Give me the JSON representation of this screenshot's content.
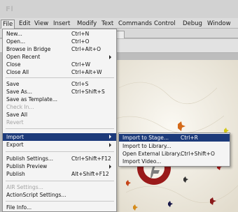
{
  "app": {
    "logo": "Fl"
  },
  "menubar": [
    "File",
    "Edit",
    "View",
    "Insert",
    "Modify",
    "Text",
    "Commands",
    "Control",
    "Debug",
    "Window"
  ],
  "document_tab": {
    "close_glyph": "×"
  },
  "file_menu": [
    {
      "label": "New...",
      "shortcut": "Ctrl+N"
    },
    {
      "label": "Open...",
      "shortcut": "Ctrl+O"
    },
    {
      "label": "Browse in Bridge",
      "shortcut": "Ctrl+Alt+O"
    },
    {
      "label": "Open Recent",
      "shortcut": "",
      "submenu": true
    },
    {
      "label": "Close",
      "shortcut": "Ctrl+W"
    },
    {
      "label": "Close All",
      "shortcut": "Ctrl+Alt+W"
    },
    {
      "label": "Save",
      "shortcut": "Ctrl+S"
    },
    {
      "label": "Save As...",
      "shortcut": "Ctrl+Shift+S"
    },
    {
      "label": "Save as Template...",
      "shortcut": ""
    },
    {
      "label": "Check In...",
      "shortcut": "",
      "disabled": true
    },
    {
      "label": "Save All",
      "shortcut": ""
    },
    {
      "label": "Revert",
      "shortcut": "",
      "disabled": true
    },
    {
      "label": "Import",
      "shortcut": "",
      "submenu": true,
      "selected": true
    },
    {
      "label": "Export",
      "shortcut": "",
      "submenu": true
    },
    {
      "label": "Publish Settings...",
      "shortcut": "Ctrl+Shift+F12"
    },
    {
      "label": "Publish Preview",
      "shortcut": "",
      "submenu": true
    },
    {
      "label": "Publish",
      "shortcut": "Alt+Shift+F12"
    },
    {
      "label": "AIR Settings...",
      "shortcut": "",
      "disabled": true
    },
    {
      "label": "ActionScript Settings...",
      "shortcut": ""
    },
    {
      "label": "File Info...",
      "shortcut": ""
    }
  ],
  "import_submenu": [
    {
      "label": "Import to Stage...",
      "shortcut": "Ctrl+R",
      "selected": true
    },
    {
      "label": "Import to Library...",
      "shortcut": ""
    },
    {
      "label": "Open External Library...",
      "shortcut": "Ctrl+Shift+O"
    },
    {
      "label": "Import Video...",
      "shortcut": ""
    }
  ],
  "colors": {
    "menu_bg": "#f4f4f4",
    "highlight": "#1c3a7a",
    "disabled_text": "#a3a3a3",
    "stage_bg": "#f3f0e8"
  }
}
